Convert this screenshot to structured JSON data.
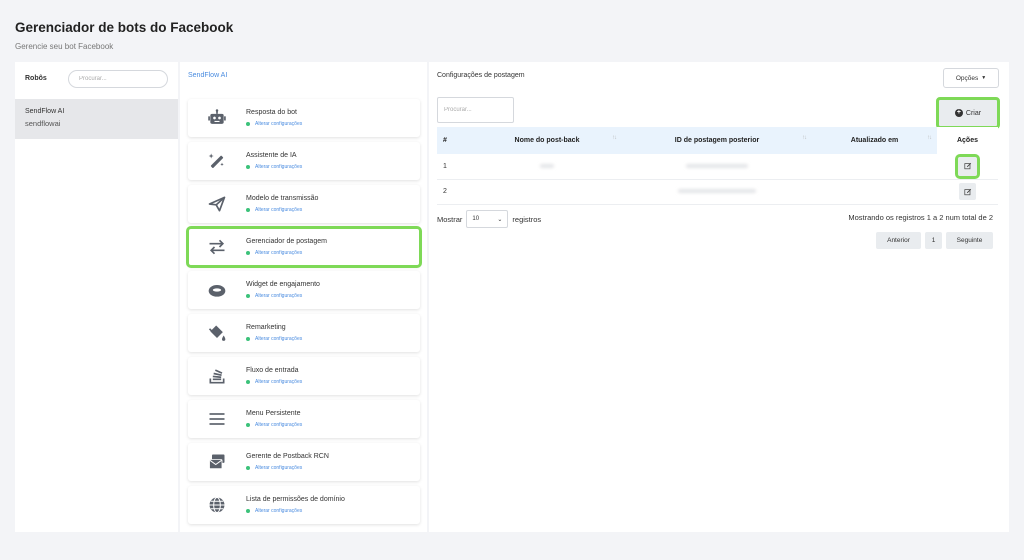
{
  "header": {
    "title": "Gerenciador de bots do Facebook",
    "subtitle": "Gerencie seu bot Facebook"
  },
  "bots_panel": {
    "label": "Robôs",
    "search_placeholder": "Procurar...",
    "bots": [
      {
        "name": "SendFlow AI",
        "handle": "sendflowai"
      }
    ]
  },
  "menu_panel": {
    "brand": "SendFlow AI",
    "status_label": "Alterar configurações",
    "items": [
      {
        "title": "Resposta do bot",
        "icon": "robot-icon"
      },
      {
        "title": "Assistente de IA",
        "icon": "magic-wand-icon"
      },
      {
        "title": "Modelo de transmissão",
        "icon": "paper-plane-icon"
      },
      {
        "title": "Gerenciador de postagem",
        "icon": "exchange-arrows-icon",
        "active": true
      },
      {
        "title": "Widget de engajamento",
        "icon": "ring-icon"
      },
      {
        "title": "Remarketing",
        "icon": "paint-bucket-icon"
      },
      {
        "title": "Fluxo de entrada",
        "icon": "inbox-stack-icon"
      },
      {
        "title": "Menu Persistente",
        "icon": "hamburger-menu-icon"
      },
      {
        "title": "Gerente de Postback RCN",
        "icon": "envelopes-icon"
      },
      {
        "title": "Lista de permissões de domínio",
        "icon": "globe-icon"
      }
    ]
  },
  "content": {
    "title": "Configurações de postagem",
    "options_label": "Opções",
    "search_placeholder": "Procurar...",
    "create_label": "Criar",
    "table": {
      "headers": [
        "#",
        "Nome do post-back",
        "ID de postagem posterior",
        "Atualizado em",
        "Ações"
      ],
      "rows": [
        {
          "num": "1"
        },
        {
          "num": "2"
        }
      ]
    },
    "length": {
      "prefix": "Mostrar",
      "value": "10",
      "suffix": "registros"
    },
    "info": "Mostrando os registros 1 a 2 num total de 2",
    "pagination": {
      "prev": "Anterior",
      "current": "1",
      "next": "Seguinte"
    }
  },
  "colors": {
    "highlight": "#7ed957",
    "accent_blue": "#4a8ce0",
    "status_green": "#3cc27a",
    "table_header_bg": "#e9f3fd"
  }
}
